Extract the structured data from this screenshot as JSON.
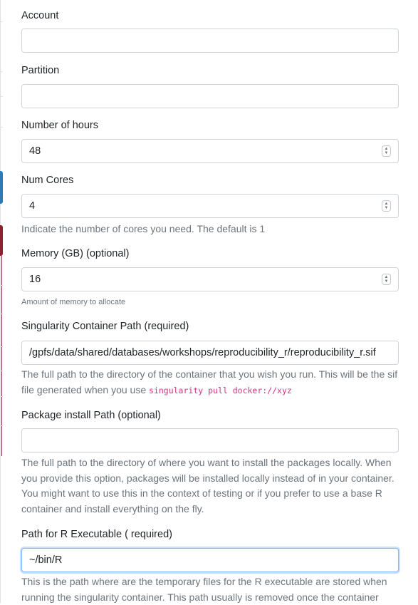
{
  "fields": {
    "account": {
      "label": "Account",
      "value": ""
    },
    "partition": {
      "label": "Partition",
      "value": ""
    },
    "hours": {
      "label": "Number of hours",
      "value": "48"
    },
    "cores": {
      "label": "Num Cores",
      "value": "4",
      "help": "Indicate the number of cores you need. The default is 1"
    },
    "memory": {
      "label": "Memory (GB) (optional)",
      "value": "16",
      "help": "Amount of memory to allocate"
    },
    "container": {
      "label": "Singularity Container Path (required)",
      "value": "/gpfs/data/shared/databases/workshops/reproducibility_r/reproducibility_r.sif",
      "help_prefix": "The full path to the directory of the container that you wish you run. This will be the sif file generated when you use",
      "help_code": "singularity pull docker://xyz"
    },
    "package_path": {
      "label": "Package install Path (optional)",
      "value": "",
      "help": "The full path to the directory of where you want to install the packages locally. When you provide this option, packages will be installed locally instead of in your container. You might want to use this in the context of testing or if you prefer to use a base R container and install everything on the fly."
    },
    "r_exec": {
      "label": "Path for R Executable ( required)",
      "value": "~/bin/R",
      "help": "This is the path where are the temporary files for the R executable are stored when running the singularity container. This path usually is removed once the container"
    }
  },
  "icons": {
    "spinner": "up-down-chevron-icon"
  },
  "colors": {
    "accent_blue": "#2c7bb6",
    "accent_maroon": "#8c2230",
    "code_pink": "#d63384",
    "help_gray": "#6c757d"
  }
}
